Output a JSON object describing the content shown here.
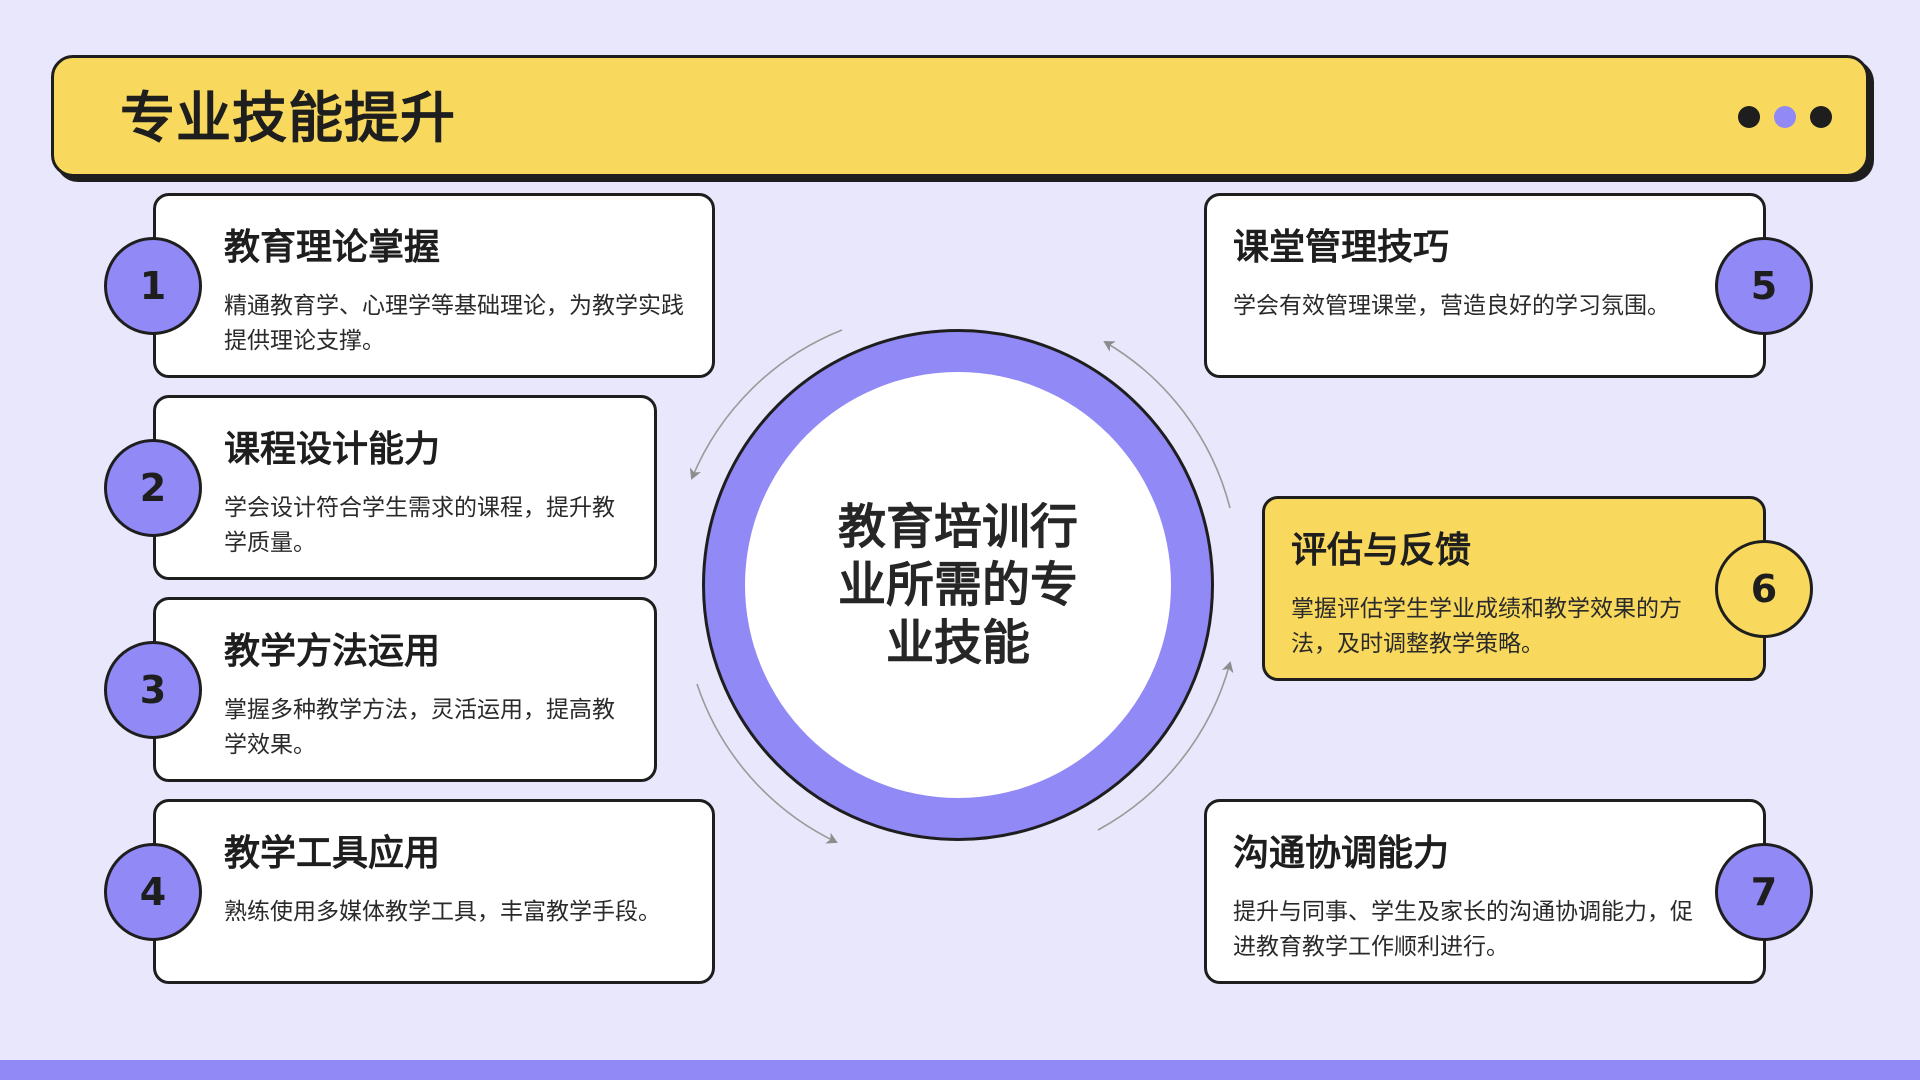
{
  "header": {
    "title": "专业技能提升"
  },
  "center": {
    "label": "教育培训行业所需的专业技能"
  },
  "skills": [
    {
      "number": "1",
      "title": "教育理论掌握",
      "desc": "精通教育学、心理学等基础理论，为教学实践提供理论支撑。"
    },
    {
      "number": "2",
      "title": "课程设计能力",
      "desc": "学会设计符合学生需求的课程，提升教学质量。"
    },
    {
      "number": "3",
      "title": "教学方法运用",
      "desc": "掌握多种教学方法，灵活运用，提高教学效果。"
    },
    {
      "number": "4",
      "title": "教学工具应用",
      "desc": "熟练使用多媒体教学工具，丰富教学手段。"
    },
    {
      "number": "5",
      "title": "课堂管理技巧",
      "desc": "学会有效管理课堂，营造良好的学习氛围。"
    },
    {
      "number": "6",
      "title": "评估与反馈",
      "desc": "掌握评估学生学业成绩和教学效果的方法，及时调整教学策略。"
    },
    {
      "number": "7",
      "title": "沟通协调能力",
      "desc": "提升与同事、学生及家长的沟通协调能力，促进教育教学工作顺利进行。"
    }
  ],
  "colors": {
    "background": "#e8e7fb",
    "accent_purple": "#9189f5",
    "accent_yellow": "#f8d95e",
    "outline": "#1e1e1e"
  }
}
